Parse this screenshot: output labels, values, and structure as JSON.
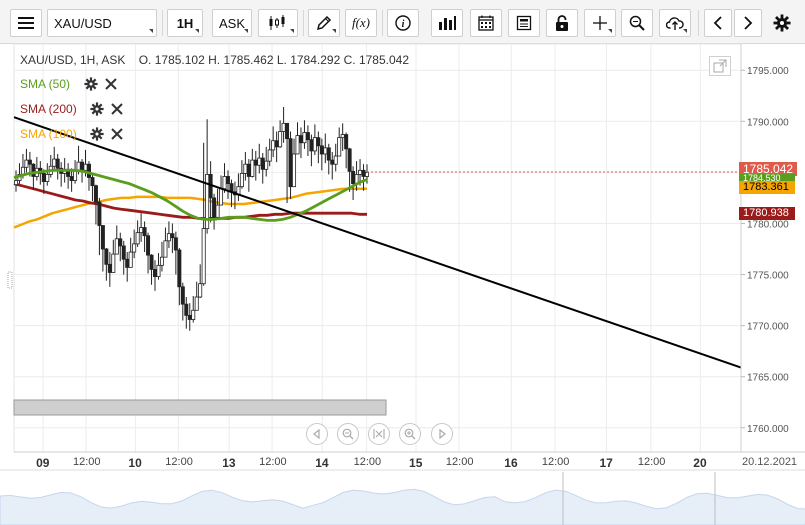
{
  "toolbar": {
    "symbol": "XAU/USD",
    "timeframe": "1H",
    "price_side": "ASK",
    "function_label": "f(x)"
  },
  "chart_header": {
    "symbol": "XAU/USD, 1H, ASK",
    "open": "O. 1785.102",
    "high": "H. 1785.462",
    "low": "L. 1784.292",
    "close": "C. 1785.042"
  },
  "indicators": [
    {
      "label": "SMA (50)",
      "color": "#5a9e1e"
    },
    {
      "label": "SMA (200)",
      "color": "#9b1b1b"
    },
    {
      "label": "SMA (100)",
      "color": "#f5a500"
    }
  ],
  "price_tags": [
    {
      "value": "1785.042",
      "color": "#e05a4a"
    },
    {
      "value": "1784.530",
      "color": "#5a9e1e"
    },
    {
      "value": "1783.361",
      "color": "#f5a500",
      "text_color": "#000000"
    },
    {
      "value": "1780.938",
      "color": "#9b1b1b"
    }
  ],
  "chart_data": {
    "type": "candlestick",
    "ylim": [
      1759,
      1796
    ],
    "y_ticks": [
      "1795.000",
      "1790.000",
      "1785.000",
      "1780.000",
      "1775.000",
      "1770.000",
      "1765.000",
      "1760.000"
    ],
    "y_tick_values": [
      1795,
      1790,
      1785,
      1780,
      1775,
      1770,
      1765,
      1760
    ],
    "x_labels": [
      {
        "text": "09",
        "kind": "day",
        "pos": 0.04
      },
      {
        "text": "12:00",
        "kind": "time",
        "pos": 0.099
      },
      {
        "text": "10",
        "kind": "day",
        "pos": 0.167
      },
      {
        "text": "12:00",
        "kind": "time",
        "pos": 0.226
      },
      {
        "text": "13",
        "kind": "day",
        "pos": 0.296
      },
      {
        "text": "12:00",
        "kind": "time",
        "pos": 0.355
      },
      {
        "text": "14",
        "kind": "day",
        "pos": 0.424
      },
      {
        "text": "12:00",
        "kind": "time",
        "pos": 0.485
      },
      {
        "text": "15",
        "kind": "day",
        "pos": 0.553
      },
      {
        "text": "12:00",
        "kind": "time",
        "pos": 0.612
      },
      {
        "text": "16",
        "kind": "day",
        "pos": 0.684
      },
      {
        "text": "12:00",
        "kind": "time",
        "pos": 0.744
      },
      {
        "text": "17",
        "kind": "day",
        "pos": 0.815
      },
      {
        "text": "12:00",
        "kind": "time",
        "pos": 0.876
      },
      {
        "text": "20",
        "kind": "day",
        "pos": 0.944
      },
      {
        "text": "20.12.2021",
        "kind": "date",
        "pos": 1.0
      }
    ],
    "candles_close": [
      1784.2,
      1784.8,
      1785.5,
      1786.2,
      1785.8,
      1784.6,
      1785.4,
      1784.9,
      1784.1,
      1784.8,
      1785.6,
      1786.3,
      1785.4,
      1784.9,
      1785.3,
      1784.6,
      1784.2,
      1785.1,
      1786.0,
      1785.2,
      1785.8,
      1784.5,
      1783.7,
      1782.1,
      1779.8,
      1777.5,
      1776.0,
      1775.2,
      1777.0,
      1778.5,
      1777.8,
      1776.5,
      1775.7,
      1777.2,
      1778.0,
      1779.1,
      1779.6,
      1778.8,
      1776.9,
      1775.5,
      1774.8,
      1775.9,
      1776.7,
      1778.3,
      1779.0,
      1778.6,
      1777.4,
      1773.8,
      1772.1,
      1771.0,
      1770.6,
      1771.5,
      1772.8,
      1774.1,
      1779.5,
      1784.8,
      1782.5,
      1780.6,
      1781.8,
      1783.4,
      1784.6,
      1783.9,
      1783.1,
      1782.8,
      1783.6,
      1784.9,
      1785.8,
      1784.6,
      1786.2,
      1785.7,
      1786.4,
      1785.3,
      1786.1,
      1787.2,
      1788.1,
      1787.5,
      1789.0,
      1789.8,
      1788.3,
      1783.6,
      1786.8,
      1788.6,
      1787.9,
      1788.9,
      1788.2,
      1787.1,
      1788.4,
      1787.6,
      1786.8,
      1787.4,
      1786.2,
      1785.8,
      1786.6,
      1788.4,
      1788.7,
      1787.3,
      1785.1,
      1783.9,
      1784.8,
      1785.2,
      1784.6,
      1785.0
    ],
    "candles_high": [
      1785.2,
      1785.9,
      1786.8,
      1787.3,
      1787.0,
      1785.9,
      1786.5,
      1786.1,
      1785.3,
      1785.9,
      1786.7,
      1787.5,
      1786.8,
      1786.0,
      1786.4,
      1785.9,
      1785.4,
      1786.2,
      1787.6,
      1786.3,
      1787.2,
      1786.1,
      1784.9,
      1783.8,
      1782.5,
      1779.1,
      1777.6,
      1777.2,
      1778.4,
      1779.8,
      1779.1,
      1778.3,
      1777.2,
      1778.6,
      1779.4,
      1780.3,
      1781.0,
      1780.2,
      1779.1,
      1777.0,
      1776.4,
      1777.1,
      1778.2,
      1779.6,
      1780.2,
      1780.0,
      1779.2,
      1777.6,
      1774.2,
      1772.8,
      1772.2,
      1772.9,
      1774.3,
      1776.0,
      1787.9,
      1790.2,
      1786.1,
      1782.9,
      1783.4,
      1784.7,
      1785.9,
      1785.2,
      1784.3,
      1784.1,
      1784.9,
      1786.2,
      1787.0,
      1786.3,
      1787.3,
      1787.1,
      1787.8,
      1786.9,
      1787.5,
      1788.3,
      1789.5,
      1789.0,
      1790.1,
      1791.4,
      1789.8,
      1789.0,
      1788.3,
      1789.9,
      1789.4,
      1790.1,
      1789.6,
      1788.7,
      1789.7,
      1789.0,
      1788.3,
      1788.8,
      1787.8,
      1787.0,
      1787.8,
      1789.4,
      1789.8,
      1788.9,
      1787.4,
      1785.6,
      1786.1,
      1786.3,
      1785.8,
      1785.8
    ],
    "candles_low": [
      1783.1,
      1783.9,
      1784.4,
      1785.0,
      1784.6,
      1783.3,
      1784.2,
      1783.8,
      1782.9,
      1783.7,
      1784.5,
      1785.1,
      1784.3,
      1783.6,
      1784.0,
      1783.4,
      1783.1,
      1783.9,
      1784.8,
      1784.0,
      1784.6,
      1783.2,
      1782.2,
      1779.9,
      1776.9,
      1775.3,
      1774.4,
      1773.8,
      1775.6,
      1777.1,
      1776.3,
      1775.0,
      1774.3,
      1775.8,
      1776.6,
      1777.7,
      1778.2,
      1777.2,
      1775.1,
      1774.0,
      1773.4,
      1774.5,
      1775.3,
      1776.9,
      1777.6,
      1777.1,
      1775.0,
      1772.0,
      1770.5,
      1769.7,
      1769.5,
      1770.3,
      1771.6,
      1772.7,
      1773.9,
      1779.0,
      1780.1,
      1779.4,
      1780.4,
      1781.9,
      1783.0,
      1782.4,
      1781.6,
      1781.4,
      1782.2,
      1783.4,
      1784.2,
      1783.1,
      1784.5,
      1784.2,
      1784.9,
      1783.9,
      1784.6,
      1785.6,
      1786.5,
      1786.0,
      1787.4,
      1787.9,
      1782.0,
      1782.4,
      1784.7,
      1786.9,
      1786.4,
      1787.3,
      1786.6,
      1785.6,
      1786.7,
      1785.9,
      1785.2,
      1785.9,
      1784.8,
      1784.3,
      1785.1,
      1786.6,
      1787.1,
      1785.4,
      1783.1,
      1782.3,
      1783.2,
      1783.7,
      1783.2,
      1783.9
    ],
    "sma50": [
      1784.5,
      1784.7,
      1784.9,
      1785.0,
      1785.1,
      1785.2,
      1785.2,
      1785.2,
      1785.2,
      1785.1,
      1784.9,
      1784.7,
      1784.5,
      1784.3,
      1784.1,
      1783.9,
      1783.6,
      1783.3,
      1783.0,
      1782.6,
      1782.2,
      1781.7,
      1781.2,
      1780.8,
      1780.5,
      1780.4,
      1780.4,
      1780.5,
      1780.6,
      1780.6,
      1780.6,
      1780.5,
      1780.4,
      1780.3,
      1780.3,
      1780.4,
      1780.6,
      1780.9,
      1781.2,
      1781.6,
      1782.0,
      1782.4,
      1782.8,
      1783.2,
      1783.6,
      1784.0,
      1784.3
    ],
    "sma100": [
      1779.6,
      1779.9,
      1780.2,
      1780.4,
      1780.7,
      1781.0,
      1781.2,
      1781.4,
      1781.6,
      1781.8,
      1782.0,
      1782.1,
      1782.3,
      1782.4,
      1782.5,
      1782.5,
      1782.6,
      1782.6,
      1782.6,
      1782.6,
      1782.5,
      1782.5,
      1782.5,
      1782.5,
      1782.4,
      1782.3,
      1782.1,
      1782.0,
      1781.9,
      1781.9,
      1781.9,
      1782.0,
      1782.1,
      1782.2,
      1782.3,
      1782.4,
      1782.5,
      1782.7,
      1782.9,
      1783.0,
      1783.1,
      1783.2,
      1783.3,
      1783.4,
      1783.4,
      1783.4,
      1783.4
    ],
    "sma200": [
      1783.9,
      1783.7,
      1783.5,
      1783.3,
      1783.1,
      1782.9,
      1782.7,
      1782.5,
      1782.3,
      1782.2,
      1782.0,
      1781.9,
      1781.7,
      1781.5,
      1781.4,
      1781.3,
      1781.2,
      1781.1,
      1781.0,
      1780.9,
      1780.8,
      1780.7,
      1780.6,
      1780.6,
      1780.5,
      1780.5,
      1780.5,
      1780.5,
      1780.5,
      1780.6,
      1780.6,
      1780.7,
      1780.8,
      1780.8,
      1780.9,
      1780.9,
      1781.0,
      1781.0,
      1781.0,
      1781.0,
      1781.0,
      1781.0,
      1781.0,
      1781.0,
      1781.0,
      1780.9,
      1780.9
    ],
    "trendline": {
      "start": 1790.4,
      "end": 1765.9
    },
    "current_price": 1785.042
  }
}
